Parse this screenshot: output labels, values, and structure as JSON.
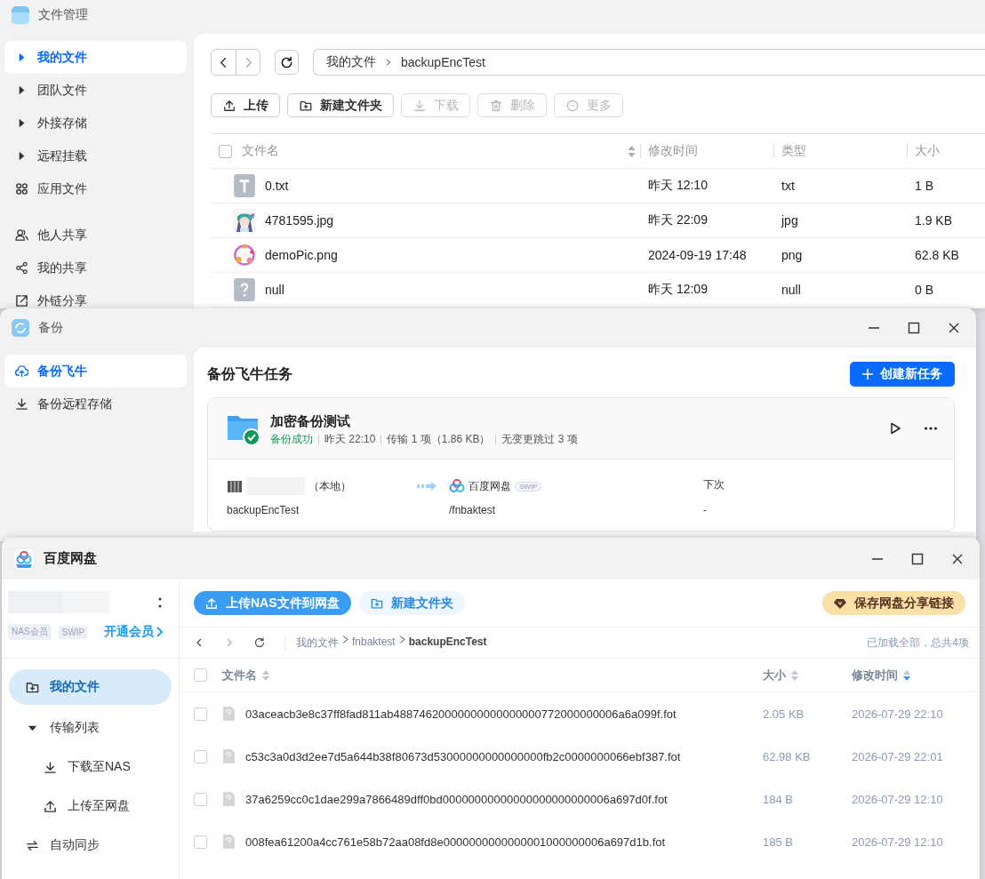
{
  "file_manager": {
    "title": "文件管理",
    "sidebar": [
      {
        "label": "我的文件",
        "selected": true
      },
      {
        "label": "团队文件",
        "selected": false
      },
      {
        "label": "外接存储",
        "selected": false
      },
      {
        "label": "远程挂载",
        "selected": false
      },
      {
        "label": "应用文件",
        "selected": false
      },
      {
        "label": "他人共享",
        "selected": false
      },
      {
        "label": "我的共享",
        "selected": false
      },
      {
        "label": "外链分享",
        "selected": false
      }
    ],
    "breadcrumb": [
      "我的文件",
      "backupEncTest"
    ],
    "toolbar": [
      {
        "label": "上传",
        "disabled": false
      },
      {
        "label": "新建文件夹",
        "disabled": false
      },
      {
        "label": "下载",
        "disabled": true
      },
      {
        "label": "删除",
        "disabled": true
      },
      {
        "label": "更多",
        "disabled": true
      }
    ],
    "all_checked": false,
    "columns": [
      {
        "label": "文件名",
        "sort_icon": true
      },
      {
        "label": "修改时间",
        "sort_icon": false
      },
      {
        "label": "类型",
        "sort_icon": false
      },
      {
        "label": "大小",
        "sort_icon": false
      }
    ],
    "rows": [
      {
        "kind": "text",
        "name": "0.txt",
        "modified": "昨天 12:10",
        "type": "txt",
        "size": "1 B"
      },
      {
        "name": "4781595.jpg",
        "modified": "昨天 22:09",
        "type": "jpg",
        "size": "1.9 KB"
      },
      {
        "name": "demoPic.png",
        "modified": "2024-09-19 17:48",
        "type": "png",
        "size": "62.8 KB"
      },
      {
        "kind": "unknown",
        "name": "null",
        "modified": "昨天 12:09",
        "type": "null",
        "size": "0 B"
      }
    ]
  },
  "backup": {
    "title": "备份",
    "sidebar": [
      {
        "label": "备份飞牛",
        "selected": true
      },
      {
        "label": "备份远程存储",
        "selected": false
      }
    ],
    "heading": "备份飞牛任务",
    "create_button": "创建新任务",
    "task": {
      "name": "加密备份测试",
      "status": "备份成功",
      "status_ok": true,
      "time": "昨天 22:10",
      "transfer": "传输 1 项（1.86 KB）",
      "skipped": "无变更跳过 3 项",
      "source_suffix": "（本地）",
      "source_path": "backupEncTest",
      "dest_name": "百度网盘",
      "dest_badge": "SWIP",
      "dest_path": "/fnbaktest",
      "next_label": "下次",
      "next_value": "-"
    }
  },
  "baidu": {
    "title": "百度网盘",
    "badges": [
      "NAS会员",
      "SWIP"
    ],
    "vip_link": "开通会员",
    "sidebar": [
      {
        "label": "我的文件",
        "selected": true
      },
      {
        "label": "传输列表",
        "selected": false,
        "expanded": true,
        "children": [
          {
            "label": "下载至NAS",
            "selected": false
          },
          {
            "label": "上传至网盘",
            "selected": false
          }
        ]
      },
      {
        "label": "自动同步",
        "selected": false
      }
    ],
    "upload_button": "上传NAS文件到网盘",
    "new_folder_button": "新建文件夹",
    "share_button": "保存网盘分享链接",
    "breadcrumb": [
      "我的文件",
      "fnbaktest",
      "backupEncTest"
    ],
    "loaded_text": "已加载全部，总共4项",
    "all_checked": false,
    "columns": [
      {
        "label": "文件名",
        "sorted": false
      },
      {
        "label": "大小",
        "sorted": false
      },
      {
        "label": "修改时间",
        "sorted": true
      }
    ],
    "rows": [
      {
        "name": "03aceacb3e8c37ff8fad811ab48874620000000000000000772000000006a6a099f.fot",
        "size": "2.05 KB",
        "modified": "2026-07-29 22:10",
        "checked": false
      },
      {
        "name": "c53c3a0d3d2ee7d5a644b38f80673d53000000000000000fb2c0000000066ebf387.fot",
        "size": "62.98 KB",
        "modified": "2026-07-29 22:01",
        "checked": false
      },
      {
        "name": "37a6259cc0c1dae299a7866489dff0bd00000000000000000000000006a697d0f.fot",
        "size": "184 B",
        "modified": "2026-07-29 12:10",
        "checked": false
      },
      {
        "name": "008fea61200a4cc761e58b72aa08fd8e0000000000000001000000006a697d1b.fot",
        "size": "185 B",
        "modified": "2026-07-29 12:10",
        "checked": false
      }
    ]
  }
}
